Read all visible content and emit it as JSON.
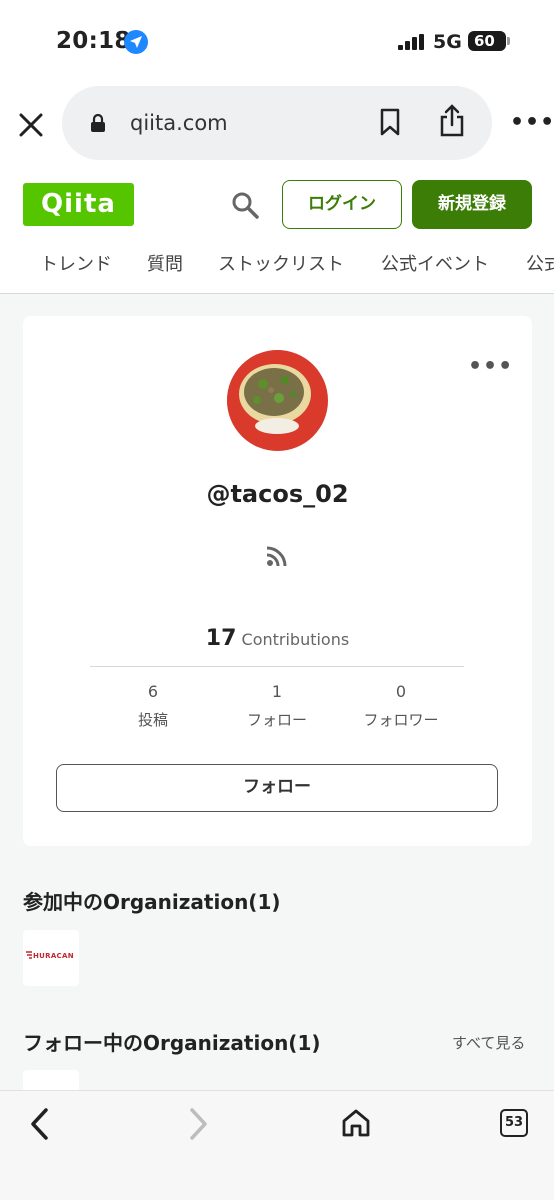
{
  "status_bar": {
    "time": "20:18",
    "network": "5G",
    "battery": "60"
  },
  "browser": {
    "url": "qiita.com",
    "tab_count": "53"
  },
  "header": {
    "logo": "Qiita",
    "login_label": "ログイン",
    "signup_label": "新規登録",
    "nav": [
      "トレンド",
      "質問",
      "ストックリスト",
      "公式イベント",
      "公式"
    ]
  },
  "profile": {
    "username": "@tacos_02",
    "contributions_count": "17",
    "contributions_label": "Contributions",
    "stats": [
      {
        "value": "6",
        "label": "投稿"
      },
      {
        "value": "1",
        "label": "フォロー"
      },
      {
        "value": "0",
        "label": "フォロワー"
      }
    ],
    "follow_label": "フォロー"
  },
  "organizations": {
    "joined_title": "参加中のOrganization(1)",
    "joined_logo_text": "HURACAN",
    "following_title": "フォロー中のOrganization(1)",
    "see_all_label": "すべて見る"
  },
  "colors": {
    "qiita_green": "#55c500",
    "button_green": "#3b7d07",
    "location_blue": "#1e88ff"
  }
}
